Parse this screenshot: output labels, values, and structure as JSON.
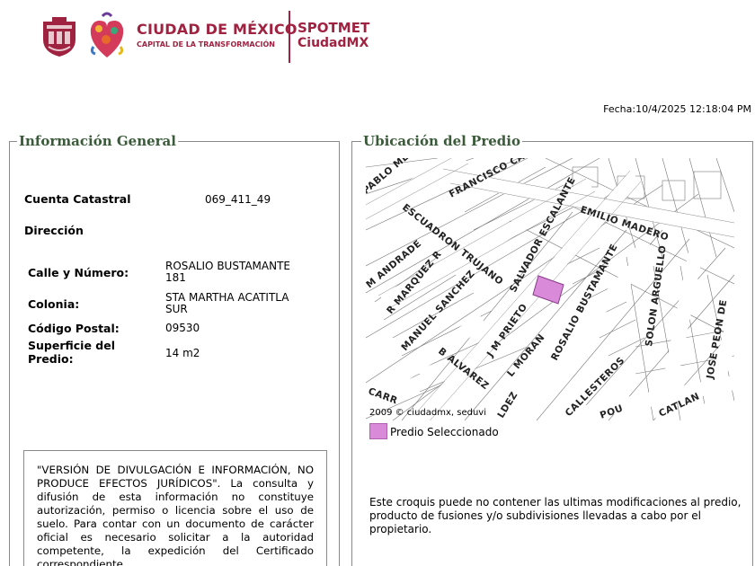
{
  "header": {
    "brand_title": "CIUDAD DE MÉXICO",
    "brand_subtitle": "CAPITAL DE LA TRANSFORMACIÓN",
    "spot_title": "SPOTMET",
    "spot_subtitle": "CiudadMX",
    "brand_color": "#9f2241"
  },
  "fecha": "Fecha:10/4/2025 12:18:04 PM",
  "info": {
    "title": "Información General",
    "cuenta_label": "Cuenta Catastral",
    "cuenta_value": "069_411_49",
    "direccion_label": "Dirección",
    "calle_label": "Calle y Número:",
    "calle_value_1": "ROSALIO BUSTAMANTE",
    "calle_value_2": "181",
    "colonia_label": "Colonia:",
    "colonia_value_1": "STA MARTHA ACATITLA",
    "colonia_value_2": "SUR",
    "cp_label": "Código Postal:",
    "cp_value": "09530",
    "superficie_label_1": "Superficie del",
    "superficie_label_2": "Predio:",
    "superficie_value": "14 m2",
    "disclaimer": "\"VERSIÓN DE DIVULGACIÓN E INFORMACIÓN, NO PRODUCE EFECTOS JURÍDICOS\". La consulta y difusión de esta información no constituye autorización, permiso o licencia sobre el uso de suelo. Para contar con un documento de carácter oficial es necesario solicitar a la autoridad competente, la expedición del Certificado correspondiente."
  },
  "ubicacion": {
    "title": "Ubicación del Predio",
    "streets": [
      "PABLO MENA",
      "FRANCISCO CA",
      "ESCUADRON TRUJANO",
      "EMILIO MADERO",
      "SALVADOR ESCALANTE",
      "M ANDRADE",
      "R MARQUEZ R",
      "ROSALIO BUSTAMANTE",
      "SOLON ARGUELLO",
      "MANUEL SANCHEZ",
      "J M PRIETO",
      "JOSE PEON DE",
      "B ALVAREZ",
      "L MORAN",
      "CARR",
      "LDEZ",
      "CALLESTEROS",
      "POU",
      "CATLAN"
    ],
    "credit": "2009 © ciudadmx, seduvi",
    "legend_label": "Predio Seleccionado",
    "legend_color": "#d98ad9",
    "note": "Este croquis puede no contener las ultimas modificaciones al predio, producto de fusiones y/o subdivisiones llevadas a cabo por el propietario."
  }
}
